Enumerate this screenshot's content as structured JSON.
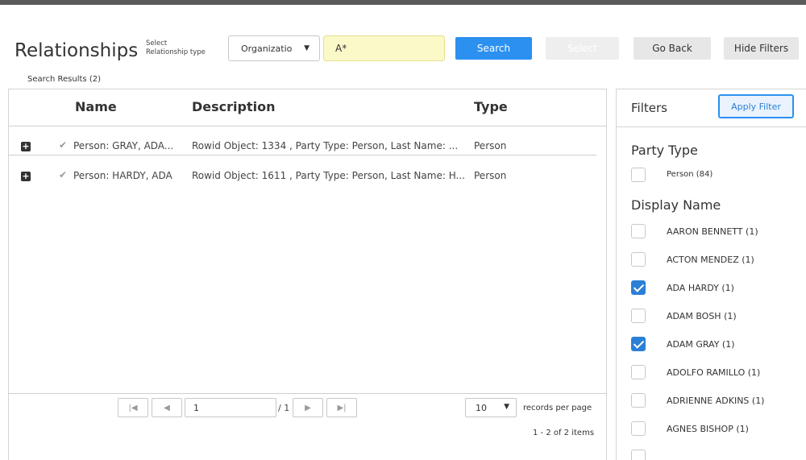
{
  "header": {
    "title": "Relationships",
    "select_label_line1": "Select",
    "select_label_line2": "Relationship type",
    "relationship_type": "Organization",
    "search_value": "A*",
    "search_button": "Search",
    "select_button": "Select",
    "go_back_button": "Go Back",
    "hide_filters_button": "Hide Filters"
  },
  "results": {
    "label": "Search Results (2)",
    "columns": [
      "Name",
      "Description",
      "Type"
    ],
    "rows": [
      {
        "name": "Person: GRAY, ADA...",
        "description": "Rowid Object: 1334 , Party Type: Person, Last Name: ...",
        "type": "Person"
      },
      {
        "name": "Person: HARDY, ADA",
        "description": "Rowid Object: 1611 , Party Type: Person, Last Name: H...",
        "type": "Person"
      }
    ]
  },
  "pager": {
    "first_icon": "first-page-icon",
    "prev_icon": "prev-page-icon",
    "next_icon": "next-page-icon",
    "last_icon": "last-page-icon",
    "page": "1",
    "of_pages": "/ 1",
    "per_page": "10",
    "per_page_label": "records per page",
    "items_count": "1 - 2 of 2 items"
  },
  "filters": {
    "title": "Filters",
    "apply_button": "Apply Filter",
    "party_type_title": "Party Type",
    "party_type_items": [
      {
        "label": "Person (84)",
        "checked": false
      }
    ],
    "display_name_title": "Display Name",
    "display_name_items": [
      {
        "label": "AARON BENNETT (1)",
        "checked": false
      },
      {
        "label": "ACTON MENDEZ (1)",
        "checked": false
      },
      {
        "label": "ADA HARDY (1)",
        "checked": true
      },
      {
        "label": "ADAM BOSH (1)",
        "checked": false
      },
      {
        "label": "ADAM GRAY (1)",
        "checked": true
      },
      {
        "label": "ADOLFO RAMILLO (1)",
        "checked": false
      },
      {
        "label": "ADRIENNE ADKINS (1)",
        "checked": false
      },
      {
        "label": "AGNES BISHOP (1)",
        "checked": false
      }
    ]
  },
  "colors": {
    "primary": "#2b90f0",
    "checked": "#2b7fd6",
    "search_field_bg": "#fbf9c8",
    "topbar": "#5a5a5a"
  }
}
